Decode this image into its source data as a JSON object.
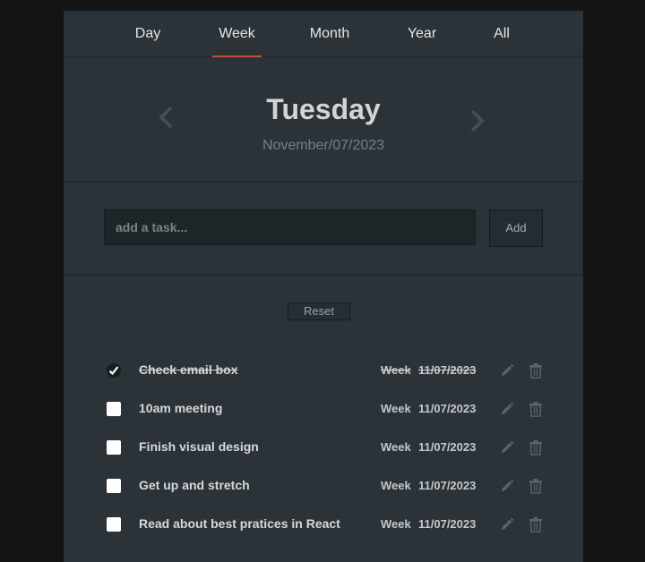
{
  "tabs": [
    {
      "label": "Day",
      "active": false
    },
    {
      "label": "Week",
      "active": true
    },
    {
      "label": "Month",
      "active": false
    },
    {
      "label": "Year",
      "active": false
    },
    {
      "label": "All",
      "active": false
    }
  ],
  "header": {
    "day": "Tuesday",
    "date": "November/07/2023"
  },
  "add_form": {
    "placeholder": "add a task...",
    "value": "",
    "add_label": "Add"
  },
  "reset_label": "Reset",
  "tasks": [
    {
      "name": "Check email box",
      "period": "Week",
      "date": "11/07/2023",
      "done": true
    },
    {
      "name": "10am meeting",
      "period": "Week",
      "date": "11/07/2023",
      "done": false
    },
    {
      "name": "Finish visual design",
      "period": "Week",
      "date": "11/07/2023",
      "done": false
    },
    {
      "name": "Get up and stretch",
      "period": "Week",
      "date": "11/07/2023",
      "done": false
    },
    {
      "name": "Read about best pratices in React",
      "period": "Week",
      "date": "11/07/2023",
      "done": false
    }
  ],
  "icons": {
    "prev": "chevron-left-icon",
    "next": "chevron-right-icon",
    "edit": "pencil-icon",
    "delete": "trash-icon",
    "check": "checkmark-icon"
  },
  "colors": {
    "background": "#141414",
    "panel": "#2c3338",
    "accent": "#c0503c",
    "input_bg": "#1e2529"
  }
}
